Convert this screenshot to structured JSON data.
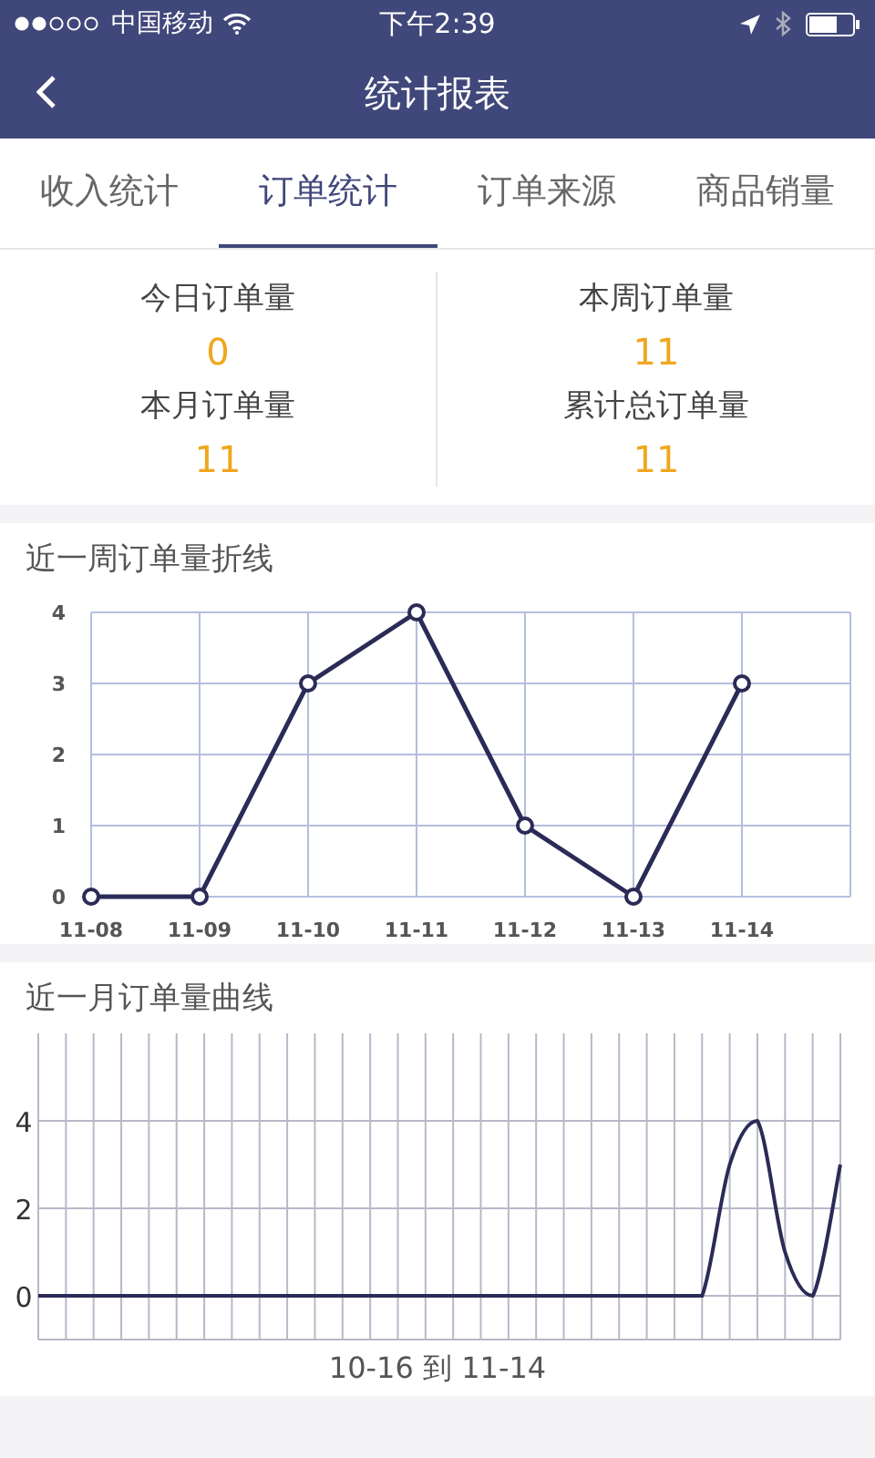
{
  "status_bar": {
    "carrier": "中国移动",
    "time": "下午2:39"
  },
  "header": {
    "title": "统计报表"
  },
  "tabs": [
    {
      "label": "收入统计",
      "selected": false
    },
    {
      "label": "订单统计",
      "selected": true
    },
    {
      "label": "订单来源",
      "selected": false
    },
    {
      "label": "商品销量",
      "selected": false
    }
  ],
  "stats": [
    {
      "label": "今日订单量",
      "value": "0"
    },
    {
      "label": "本周订单量",
      "value": "11"
    },
    {
      "label": "本月订单量",
      "value": "11"
    },
    {
      "label": "累计总订单量",
      "value": "11"
    }
  ],
  "week_chart": {
    "title": "近一周订单量折线",
    "chart_data": {
      "type": "line",
      "categories": [
        "11-08",
        "11-09",
        "11-10",
        "11-11",
        "11-12",
        "11-13",
        "11-14"
      ],
      "grid": true,
      "series": [
        {
          "color": "#2b2b57",
          "marker": "circle",
          "values": [
            0,
            0,
            3,
            4,
            1,
            0,
            3
          ]
        }
      ],
      "ylim": [
        0,
        4
      ],
      "yticks": [
        0,
        1,
        2,
        3,
        4
      ]
    }
  },
  "month_chart": {
    "title": "近一月订单量曲线",
    "chart_data": {
      "type": "line",
      "xlabel": "10-16 到 11-14",
      "grid": true,
      "series": [
        {
          "color": "#2b2b57",
          "values": [
            0,
            0,
            0,
            0,
            0,
            0,
            0,
            0,
            0,
            0,
            0,
            0,
            0,
            0,
            0,
            0,
            0,
            0,
            0,
            0,
            0,
            0,
            0,
            0,
            0,
            3,
            4,
            1,
            0,
            3
          ]
        }
      ],
      "ylim": [
        -1,
        6
      ],
      "yticks": [
        0,
        2,
        4
      ]
    }
  }
}
